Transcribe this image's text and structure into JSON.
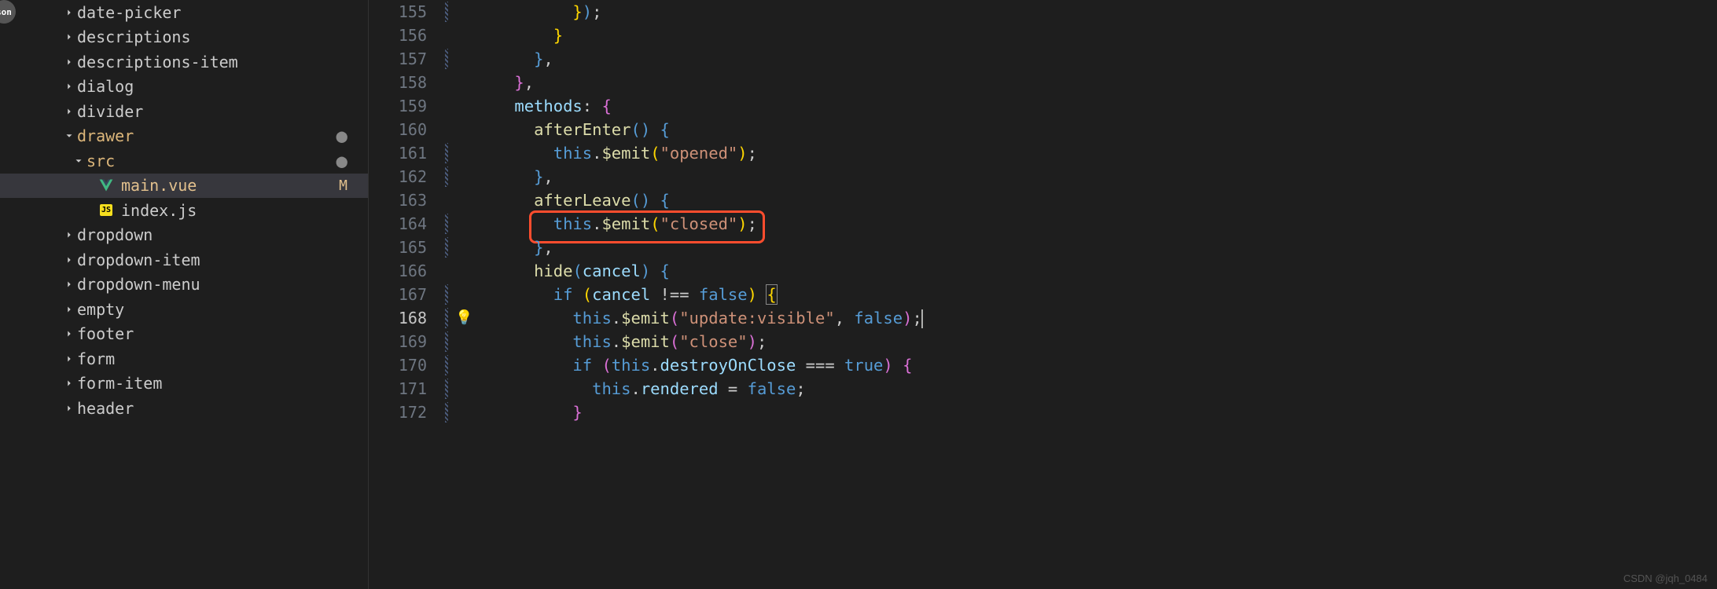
{
  "sidebar": {
    "badge": "son",
    "items": [
      {
        "label": "date-picker",
        "type": "folder",
        "expanded": false,
        "indent": 1
      },
      {
        "label": "descriptions",
        "type": "folder",
        "expanded": false,
        "indent": 1
      },
      {
        "label": "descriptions-item",
        "type": "folder",
        "expanded": false,
        "indent": 1
      },
      {
        "label": "dialog",
        "type": "folder",
        "expanded": false,
        "indent": 1
      },
      {
        "label": "divider",
        "type": "folder",
        "expanded": false,
        "indent": 1
      },
      {
        "label": "drawer",
        "type": "folder",
        "expanded": true,
        "indent": 1,
        "status": "dot",
        "highlighted": true
      },
      {
        "label": "src",
        "type": "folder",
        "expanded": true,
        "indent": 2,
        "status": "dot",
        "highlighted": true
      },
      {
        "label": "main.vue",
        "type": "file",
        "icon": "vue",
        "indent": 3,
        "status": "M",
        "selected": true,
        "modified": true
      },
      {
        "label": "index.js",
        "type": "file",
        "icon": "js",
        "indent": 3
      },
      {
        "label": "dropdown",
        "type": "folder",
        "expanded": false,
        "indent": 1
      },
      {
        "label": "dropdown-item",
        "type": "folder",
        "expanded": false,
        "indent": 1
      },
      {
        "label": "dropdown-menu",
        "type": "folder",
        "expanded": false,
        "indent": 1
      },
      {
        "label": "empty",
        "type": "folder",
        "expanded": false,
        "indent": 1
      },
      {
        "label": "footer",
        "type": "folder",
        "expanded": false,
        "indent": 1
      },
      {
        "label": "form",
        "type": "folder",
        "expanded": false,
        "indent": 1
      },
      {
        "label": "form-item",
        "type": "folder",
        "expanded": false,
        "indent": 1
      },
      {
        "label": "header",
        "type": "folder",
        "expanded": false,
        "indent": 1
      }
    ]
  },
  "editor": {
    "current_line": 168,
    "lines": [
      {
        "num": 155,
        "fold": true,
        "tokens": [
          {
            "t": "          ",
            "c": ""
          },
          {
            "t": "}",
            "c": "brace3"
          },
          {
            "t": ")",
            "c": "brace2"
          },
          {
            "t": ";",
            "c": "punct"
          }
        ]
      },
      {
        "num": 156,
        "fold": false,
        "tokens": [
          {
            "t": "        ",
            "c": ""
          },
          {
            "t": "}",
            "c": "brace3"
          }
        ]
      },
      {
        "num": 157,
        "fold": true,
        "tokens": [
          {
            "t": "      ",
            "c": ""
          },
          {
            "t": "}",
            "c": "brace2"
          },
          {
            "t": ",",
            "c": "punct"
          }
        ]
      },
      {
        "num": 158,
        "fold": false,
        "tokens": [
          {
            "t": "    ",
            "c": ""
          },
          {
            "t": "}",
            "c": "brace"
          },
          {
            "t": ",",
            "c": "punct"
          }
        ]
      },
      {
        "num": 159,
        "fold": false,
        "tokens": [
          {
            "t": "    ",
            "c": ""
          },
          {
            "t": "methods",
            "c": "var"
          },
          {
            "t": ": ",
            "c": "punct"
          },
          {
            "t": "{",
            "c": "brace"
          }
        ]
      },
      {
        "num": 160,
        "fold": false,
        "tokens": [
          {
            "t": "      ",
            "c": ""
          },
          {
            "t": "afterEnter",
            "c": "func"
          },
          {
            "t": "()",
            "c": "brace2"
          },
          {
            "t": " ",
            "c": ""
          },
          {
            "t": "{",
            "c": "brace2"
          }
        ]
      },
      {
        "num": 161,
        "fold": true,
        "tokens": [
          {
            "t": "        ",
            "c": ""
          },
          {
            "t": "this",
            "c": "this"
          },
          {
            "t": ".",
            "c": "punct"
          },
          {
            "t": "$emit",
            "c": "func"
          },
          {
            "t": "(",
            "c": "brace3"
          },
          {
            "t": "\"opened\"",
            "c": "string"
          },
          {
            "t": ")",
            "c": "brace3"
          },
          {
            "t": ";",
            "c": "punct"
          }
        ]
      },
      {
        "num": 162,
        "fold": true,
        "tokens": [
          {
            "t": "      ",
            "c": ""
          },
          {
            "t": "}",
            "c": "brace2"
          },
          {
            "t": ",",
            "c": "punct"
          }
        ]
      },
      {
        "num": 163,
        "fold": false,
        "tokens": [
          {
            "t": "      ",
            "c": ""
          },
          {
            "t": "afterLeave",
            "c": "func"
          },
          {
            "t": "()",
            "c": "brace2"
          },
          {
            "t": " ",
            "c": ""
          },
          {
            "t": "{",
            "c": "brace2"
          }
        ]
      },
      {
        "num": 164,
        "fold": true,
        "tokens": [
          {
            "t": "        ",
            "c": ""
          },
          {
            "t": "this",
            "c": "this"
          },
          {
            "t": ".",
            "c": "punct"
          },
          {
            "t": "$emit",
            "c": "func"
          },
          {
            "t": "(",
            "c": "brace3"
          },
          {
            "t": "\"closed\"",
            "c": "string"
          },
          {
            "t": ")",
            "c": "brace3"
          },
          {
            "t": ";",
            "c": "punct"
          }
        ]
      },
      {
        "num": 165,
        "fold": true,
        "tokens": [
          {
            "t": "      ",
            "c": ""
          },
          {
            "t": "}",
            "c": "brace2"
          },
          {
            "t": ",",
            "c": "punct"
          }
        ]
      },
      {
        "num": 166,
        "fold": false,
        "tokens": [
          {
            "t": "      ",
            "c": ""
          },
          {
            "t": "hide",
            "c": "func"
          },
          {
            "t": "(",
            "c": "brace2"
          },
          {
            "t": "cancel",
            "c": "param"
          },
          {
            "t": ")",
            "c": "brace2"
          },
          {
            "t": " ",
            "c": ""
          },
          {
            "t": "{",
            "c": "brace2"
          }
        ]
      },
      {
        "num": 167,
        "fold": true,
        "tokens": [
          {
            "t": "        ",
            "c": ""
          },
          {
            "t": "if",
            "c": "keyword"
          },
          {
            "t": " ",
            "c": ""
          },
          {
            "t": "(",
            "c": "brace3"
          },
          {
            "t": "cancel",
            "c": "var"
          },
          {
            "t": " !== ",
            "c": "punct"
          },
          {
            "t": "false",
            "c": "bool"
          },
          {
            "t": ")",
            "c": "brace3"
          },
          {
            "t": " ",
            "c": ""
          },
          {
            "t": "{",
            "c": "brace3",
            "bracket": true
          }
        ]
      },
      {
        "num": 168,
        "fold": true,
        "current": true,
        "lightbulb": true,
        "cursor_after": true,
        "tokens": [
          {
            "t": "          ",
            "c": ""
          },
          {
            "t": "this",
            "c": "this"
          },
          {
            "t": ".",
            "c": "punct"
          },
          {
            "t": "$emit",
            "c": "func"
          },
          {
            "t": "(",
            "c": "brace"
          },
          {
            "t": "\"update:visible\"",
            "c": "string"
          },
          {
            "t": ", ",
            "c": "punct"
          },
          {
            "t": "false",
            "c": "bool"
          },
          {
            "t": ")",
            "c": "brace"
          },
          {
            "t": ";",
            "c": "punct"
          }
        ]
      },
      {
        "num": 169,
        "fold": true,
        "tokens": [
          {
            "t": "          ",
            "c": ""
          },
          {
            "t": "this",
            "c": "this"
          },
          {
            "t": ".",
            "c": "punct"
          },
          {
            "t": "$emit",
            "c": "func"
          },
          {
            "t": "(",
            "c": "brace"
          },
          {
            "t": "\"close\"",
            "c": "string"
          },
          {
            "t": ")",
            "c": "brace"
          },
          {
            "t": ";",
            "c": "punct"
          }
        ]
      },
      {
        "num": 170,
        "fold": true,
        "tokens": [
          {
            "t": "          ",
            "c": ""
          },
          {
            "t": "if",
            "c": "keyword"
          },
          {
            "t": " ",
            "c": ""
          },
          {
            "t": "(",
            "c": "brace"
          },
          {
            "t": "this",
            "c": "this"
          },
          {
            "t": ".",
            "c": "punct"
          },
          {
            "t": "destroyOnClose",
            "c": "var"
          },
          {
            "t": " === ",
            "c": "punct"
          },
          {
            "t": "true",
            "c": "bool"
          },
          {
            "t": ")",
            "c": "brace"
          },
          {
            "t": " ",
            "c": ""
          },
          {
            "t": "{",
            "c": "brace"
          }
        ]
      },
      {
        "num": 171,
        "fold": true,
        "tokens": [
          {
            "t": "            ",
            "c": ""
          },
          {
            "t": "this",
            "c": "this"
          },
          {
            "t": ".",
            "c": "punct"
          },
          {
            "t": "rendered",
            "c": "var"
          },
          {
            "t": " = ",
            "c": "punct"
          },
          {
            "t": "false",
            "c": "bool"
          },
          {
            "t": ";",
            "c": "punct"
          }
        ]
      },
      {
        "num": 172,
        "fold": true,
        "tokens": [
          {
            "t": "          ",
            "c": ""
          },
          {
            "t": "}",
            "c": "brace"
          }
        ]
      }
    ]
  },
  "watermark": "CSDN @jqh_0484"
}
